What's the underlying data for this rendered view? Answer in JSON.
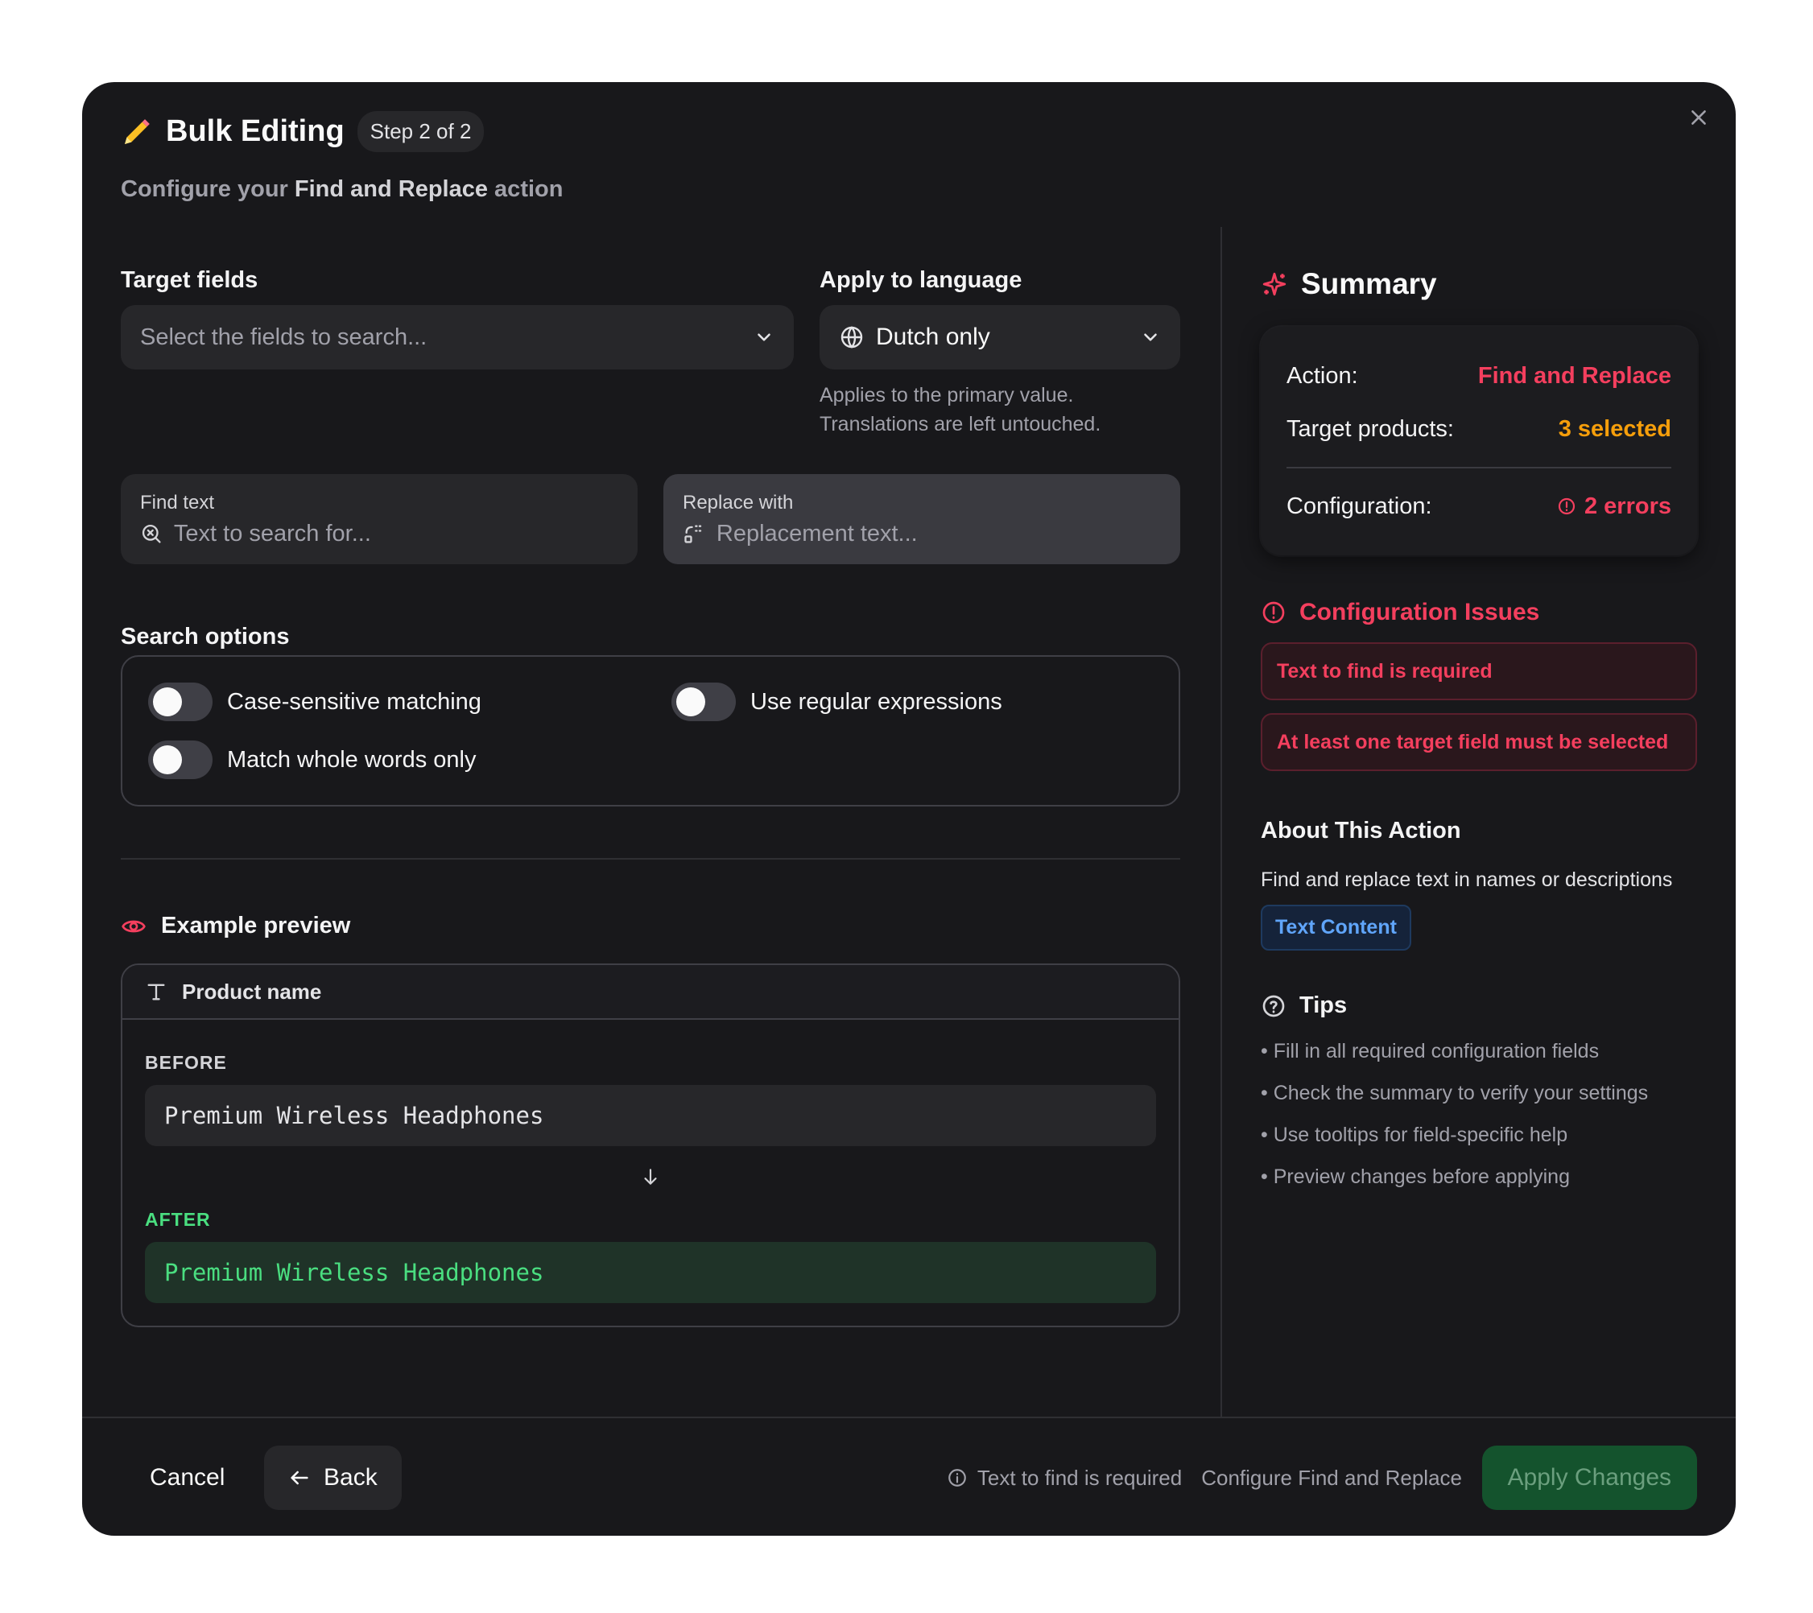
{
  "header": {
    "title": "Bulk Editing",
    "step_badge": "Step 2 of 2",
    "subtitle_prefix": "Configure your ",
    "subtitle_bold": "Find and Replace",
    "subtitle_suffix": " action"
  },
  "target_fields": {
    "label": "Target fields",
    "placeholder": "Select the fields to search..."
  },
  "language": {
    "label": "Apply to language",
    "value": "Dutch only",
    "help_line1": "Applies to the primary value.",
    "help_line2": "Translations are left untouched."
  },
  "find": {
    "label": "Find text",
    "placeholder": "Text to search for..."
  },
  "replace": {
    "label": "Replace with",
    "placeholder": "Replacement text..."
  },
  "search_options": {
    "label": "Search options",
    "case_sensitive": "Case-sensitive matching",
    "regex": "Use regular expressions",
    "whole_words": "Match whole words only"
  },
  "preview": {
    "label": "Example preview",
    "field_name": "Product name",
    "before_label": "BEFORE",
    "before_value": "Premium Wireless Headphones",
    "after_label": "AFTER",
    "after_value": "Premium Wireless Headphones"
  },
  "summary": {
    "title": "Summary",
    "action_key": "Action:",
    "action_value": "Find and Replace",
    "targets_key": "Target products:",
    "targets_value": "3 selected",
    "config_key": "Configuration:",
    "config_value": "2 errors"
  },
  "issues": {
    "title": "Configuration Issues",
    "items": [
      "Text to find is required",
      "At least one target field must be selected"
    ]
  },
  "about": {
    "title": "About This Action",
    "description": "Find and replace text in names or descriptions",
    "tag": "Text Content"
  },
  "tips": {
    "title": "Tips",
    "items": [
      "• Fill in all required configuration fields",
      "• Check the summary to verify your settings",
      "• Use tooltips for field-specific help",
      "• Preview changes before applying"
    ]
  },
  "footer": {
    "cancel": "Cancel",
    "back": "Back",
    "warning": "Text to find is required",
    "context": "Configure Find and Replace",
    "apply": "Apply Changes"
  },
  "colors": {
    "accent_pink": "#f43f5e",
    "accent_orange": "#f59e0b",
    "success_green": "#4ade80",
    "info_blue": "#60a5fa"
  }
}
